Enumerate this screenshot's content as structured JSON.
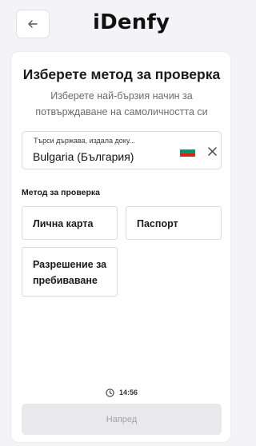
{
  "header": {
    "back_icon": "arrow-left-icon",
    "logo_text": "iDenfy"
  },
  "main": {
    "title": "Изберете метод за проверка",
    "subtitle": "Изберете най-бързия начин за потвърждаване на самоличността си",
    "country_field": {
      "placeholder": "Търси държава, издала доку...",
      "value": "Bulgaria (България)",
      "flag_colors": [
        "#ffffff",
        "#00966e",
        "#d62612"
      ],
      "clear_icon": "close-icon"
    },
    "method_label": "Метод за проверка",
    "options": [
      {
        "label": "Лична карта"
      },
      {
        "label": "Паспорт"
      },
      {
        "label": "Разрешение за пребиваване"
      }
    ],
    "timer": {
      "icon": "clock-icon",
      "value": "14:56"
    },
    "next_button": {
      "label": "Напред",
      "enabled": false
    }
  },
  "colors": {
    "background": "#f4f4f6",
    "card": "#ffffff",
    "disabled_button": "#e9e9ec",
    "disabled_text": "#a2a2a8"
  }
}
